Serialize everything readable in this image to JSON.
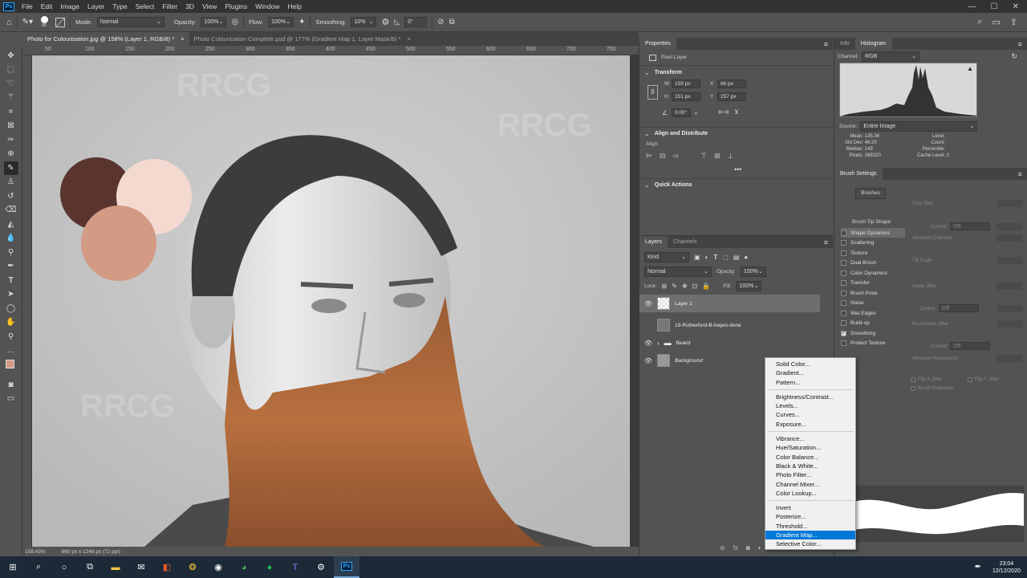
{
  "menu": [
    "File",
    "Edit",
    "Image",
    "Layer",
    "Type",
    "Select",
    "Filter",
    "3D",
    "View",
    "Plugins",
    "Window",
    "Help"
  ],
  "window_controls": {
    "minimize": "—",
    "maximize": "☐",
    "close": "✕"
  },
  "options": {
    "brush_size": "90",
    "mode_label": "Mode:",
    "mode_value": "Normal",
    "opacity_label": "Opacity:",
    "opacity_value": "100%",
    "flow_label": "Flow:",
    "flow_value": "100%",
    "smoothing_label": "Smoothing:",
    "smoothing_value": "10%",
    "angle_value": "0°"
  },
  "tabs": [
    {
      "label": "Photo for Colourisation.jpg @ 158% (Layer 1, RGB/8) *",
      "close": "×"
    },
    {
      "label": "Photo Colourisation Complete.psd @ 177% (Gradient Map 1, Layer Mask/8) *",
      "close": "×"
    }
  ],
  "ruler_h": [
    "50",
    "100",
    "150",
    "200",
    "250",
    "300",
    "350",
    "400",
    "450",
    "500",
    "550",
    "600",
    "650",
    "700",
    "750"
  ],
  "status": {
    "zoom": "158.43%",
    "doc": "860 px x 1248 px (72 ppi)"
  },
  "properties": {
    "tab": "Properties",
    "layer_type": "Pixel Layer",
    "transform_title": "Transform",
    "w_label": "W",
    "w_value": "159 px",
    "x_label": "X",
    "x_value": "66 px",
    "h_label": "H",
    "h_value": "151 px",
    "y_label": "Y",
    "y_value": "257 px",
    "angle_value": "0.00°",
    "align_title": "Align and Distribute",
    "align_label": "Align:",
    "quick_title": "Quick Actions"
  },
  "layers": {
    "tabs": [
      "Layers",
      "Channels"
    ],
    "kind": "Kind",
    "blend": "Normal",
    "opacity_label": "Opacity:",
    "opacity_value": "100%",
    "lock_label": "Lock:",
    "fill_label": "Fill:",
    "fill_value": "100%",
    "items": [
      {
        "name": "Layer 1",
        "visible": true
      },
      {
        "name": "19-Rutherford-B-hayes-done",
        "visible": false
      },
      {
        "name": "Beard",
        "visible": true
      },
      {
        "name": "Background",
        "visible": true
      }
    ]
  },
  "adjust_menu": {
    "groups": [
      [
        "Solid Color...",
        "Gradient...",
        "Pattern..."
      ],
      [
        "Brightness/Contrast...",
        "Levels...",
        "Curves...",
        "Exposure..."
      ],
      [
        "Vibrance...",
        "Hue/Saturation...",
        "Color Balance...",
        "Black & White...",
        "Photo Filter...",
        "Channel Mixer...",
        "Color Lookup..."
      ],
      [
        "Invert",
        "Posterize...",
        "Threshold...",
        "Gradient Map...",
        "Selective Color..."
      ]
    ],
    "highlighted": "Gradient Map..."
  },
  "histogram": {
    "tabs": [
      "Info",
      "Histogram"
    ],
    "channel_label": "Channel:",
    "channel_value": "RGB",
    "source_label": "Source:",
    "source_value": "Entire Image",
    "stats": [
      {
        "label": "Mean:",
        "value": "135.36"
      },
      {
        "label": "Std Dev:",
        "value": "46.20"
      },
      {
        "label": "Median:",
        "value": "149"
      },
      {
        "label": "Pixels:",
        "value": "268320"
      }
    ],
    "stats_right": [
      {
        "label": "Level:",
        "value": ""
      },
      {
        "label": "Count:",
        "value": ""
      },
      {
        "label": "Percentile:",
        "value": ""
      },
      {
        "label": "Cache Level:",
        "value": "2"
      }
    ]
  },
  "brush_settings": {
    "tab": "Brush Settings",
    "brushes_btn": "Brushes",
    "tip_shape": "Brush Tip Shape",
    "items": [
      {
        "label": "Shape Dynamics",
        "checked": false
      },
      {
        "label": "Scattering",
        "checked": false
      },
      {
        "label": "Texture",
        "checked": false
      },
      {
        "label": "Dual Brush",
        "checked": false
      },
      {
        "label": "Color Dynamics",
        "checked": false
      },
      {
        "label": "Transfer",
        "checked": false
      },
      {
        "label": "Brush Pose",
        "checked": false
      },
      {
        "label": "Noise",
        "checked": false
      },
      {
        "label": "Wet Edges",
        "checked": false
      },
      {
        "label": "Build-up",
        "checked": false
      },
      {
        "label": "Smoothing",
        "checked": true
      },
      {
        "label": "Protect Texture",
        "checked": false
      }
    ],
    "right_labels": {
      "size_jitter": "Size Jitter",
      "control1": "Control:",
      "off1": "Off",
      "min_diameter": "Minimum Diameter",
      "tilt_scale": "Tilt Scale",
      "angle_jitter": "Angle Jitter",
      "control2": "Control:",
      "off2": "Off",
      "roundness_jitter": "Roundness Jitter",
      "control3": "Control:",
      "off3": "Off",
      "min_roundness": "Minimum Roundness",
      "flip_x": "Flip X Jitter",
      "flip_y": "Flip Y Jitter",
      "brush_projection": "Brush Projection"
    }
  },
  "swatches": {
    "dark": "#5a3530",
    "light": "#f3d9cf",
    "mid": "#d39a84"
  },
  "taskbar": {
    "time": "23:04",
    "date": "12/12/2020"
  },
  "watermark": "RRCG"
}
